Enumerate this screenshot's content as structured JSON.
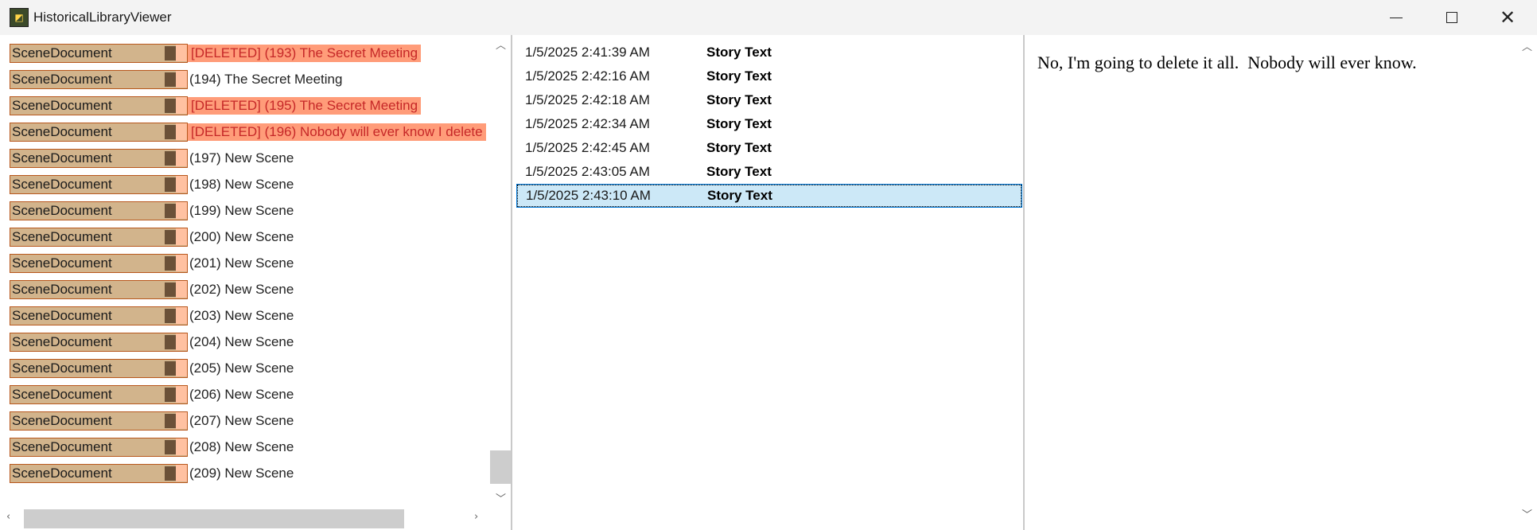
{
  "window": {
    "title": "HistoricalLibraryViewer",
    "icon": "app-icon",
    "controls": {
      "minimize_icon": "minimize-icon",
      "maximize_icon": "maximize-icon",
      "close_icon": "close-icon",
      "close_glyph": "✕"
    }
  },
  "tree": {
    "tag_label": "SceneDocument",
    "rows": [
      {
        "text": "[DELETED] (193) The Secret Meeting",
        "deleted": true
      },
      {
        "text": "(194) The Secret Meeting",
        "deleted": false
      },
      {
        "text": "[DELETED] (195) The Secret Meeting",
        "deleted": true
      },
      {
        "text": "[DELETED] (196) Nobody will ever know I delete",
        "deleted": true
      },
      {
        "text": "(197) New Scene",
        "deleted": false
      },
      {
        "text": "(198) New Scene",
        "deleted": false
      },
      {
        "text": "(199) New Scene",
        "deleted": false
      },
      {
        "text": "(200) New Scene",
        "deleted": false
      },
      {
        "text": "(201) New Scene",
        "deleted": false
      },
      {
        "text": "(202) New Scene",
        "deleted": false
      },
      {
        "text": "(203) New Scene",
        "deleted": false
      },
      {
        "text": "(204) New Scene",
        "deleted": false
      },
      {
        "text": "(205) New Scene",
        "deleted": false
      },
      {
        "text": "(206) New Scene",
        "deleted": false
      },
      {
        "text": "(207) New Scene",
        "deleted": false
      },
      {
        "text": "(208) New Scene",
        "deleted": false
      },
      {
        "text": "(209) New Scene",
        "deleted": false
      }
    ],
    "colors": {
      "tag_fill": "#d2b48c",
      "tag_border": "#b8571c",
      "deleted_bg": "#ff9c79",
      "deleted_text": "#c62828"
    }
  },
  "history": {
    "rows": [
      {
        "time": "1/5/2025 2:41:39 AM",
        "type": "Story Text",
        "selected": false
      },
      {
        "time": "1/5/2025 2:42:16 AM",
        "type": "Story Text",
        "selected": false
      },
      {
        "time": "1/5/2025 2:42:18 AM",
        "type": "Story Text",
        "selected": false
      },
      {
        "time": "1/5/2025 2:42:34 AM",
        "type": "Story Text",
        "selected": false
      },
      {
        "time": "1/5/2025 2:42:45 AM",
        "type": "Story Text",
        "selected": false
      },
      {
        "time": "1/5/2025 2:43:05 AM",
        "type": "Story Text",
        "selected": false
      },
      {
        "time": "1/5/2025 2:43:10 AM",
        "type": "Story Text",
        "selected": true
      }
    ],
    "selection_color": "#cce8f7"
  },
  "document": {
    "text": "No, I'm going to delete it all.  Nobody will ever know."
  }
}
